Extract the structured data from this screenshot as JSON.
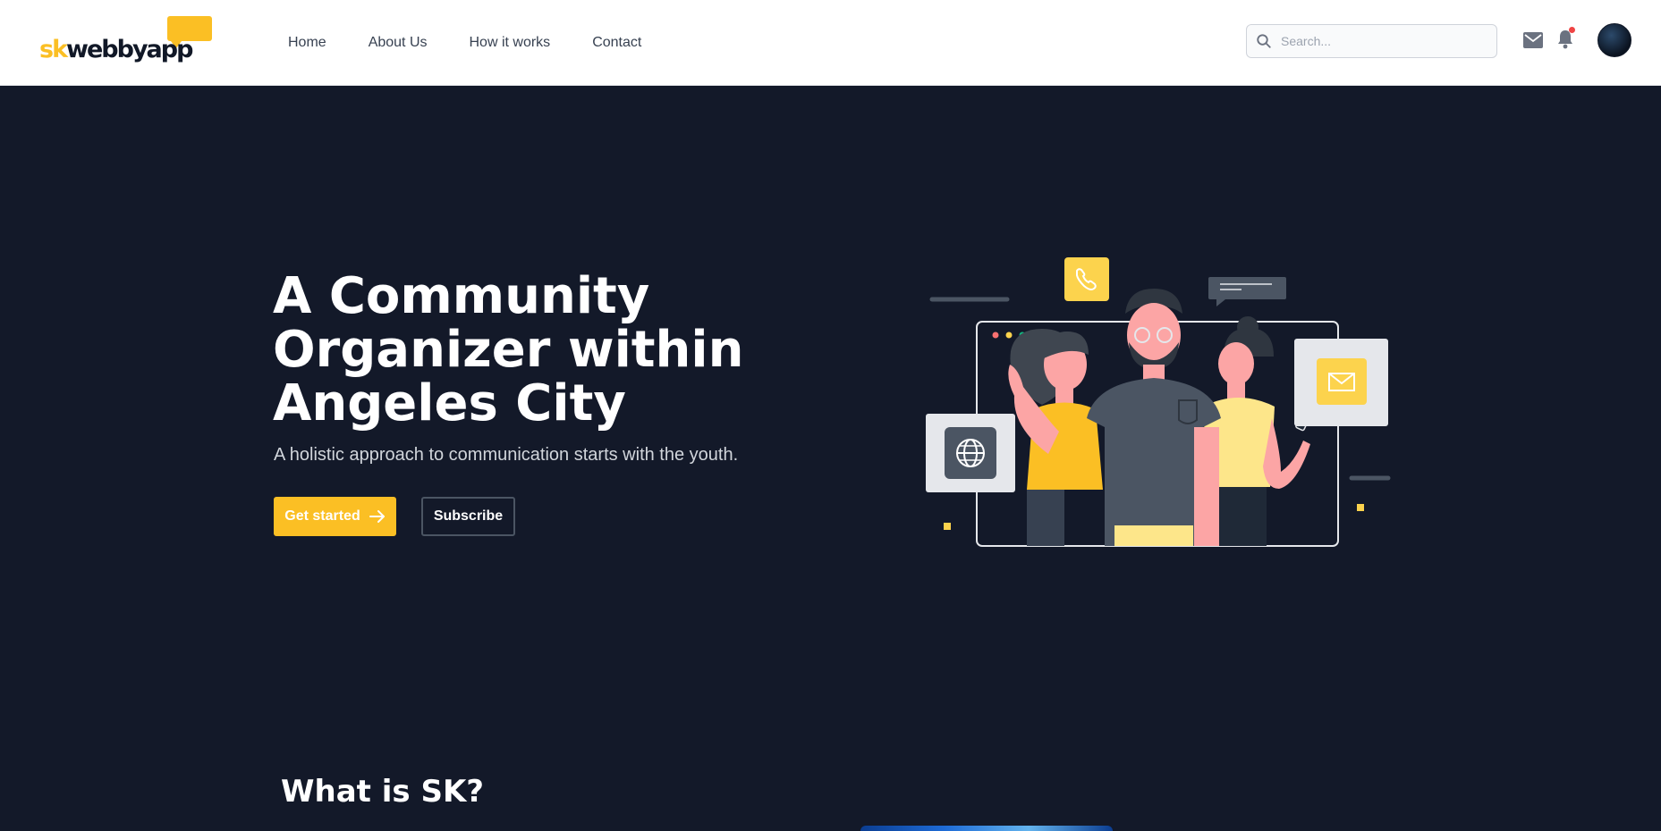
{
  "header": {
    "logo": {
      "prefix": "sk",
      "name": "webbyapp"
    },
    "nav": [
      {
        "label": "Home"
      },
      {
        "label": "About Us"
      },
      {
        "label": "How it works"
      },
      {
        "label": "Contact"
      }
    ],
    "search": {
      "placeholder": "Search...",
      "value": ""
    },
    "icons": {
      "mail": "envelope-icon",
      "notifications": "bell-icon",
      "has_unread_notification": true
    }
  },
  "hero": {
    "title": "A Community Organizer within Angeles City",
    "subtitle": "A holistic approach to communication starts with the youth.",
    "primary_button": "Get started",
    "secondary_button": "Subscribe"
  },
  "section": {
    "title": "What is SK?"
  },
  "colors": {
    "brand_accent": "#fbbf24",
    "background": "#131929",
    "header": "#ffffff"
  }
}
